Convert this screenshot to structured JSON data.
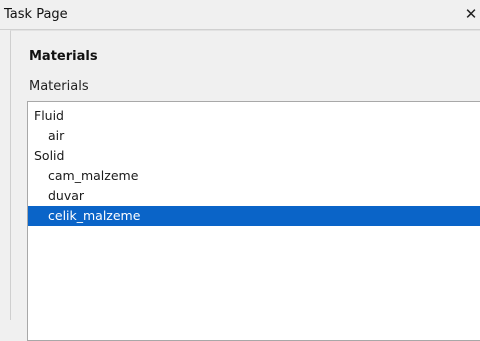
{
  "window": {
    "title": "Task Page",
    "close_icon": "close-icon"
  },
  "panel": {
    "heading": "Materials",
    "group_label": "Materials"
  },
  "materials_list": {
    "items": [
      {
        "label": "Fluid",
        "kind": "category"
      },
      {
        "label": "air",
        "kind": "child"
      },
      {
        "label": "Solid",
        "kind": "category"
      },
      {
        "label": "cam_malzeme",
        "kind": "child"
      },
      {
        "label": "duvar",
        "kind": "child"
      },
      {
        "label": "celik_malzeme",
        "kind": "child",
        "selected": true
      }
    ],
    "selection_color": "#0a64c8"
  }
}
